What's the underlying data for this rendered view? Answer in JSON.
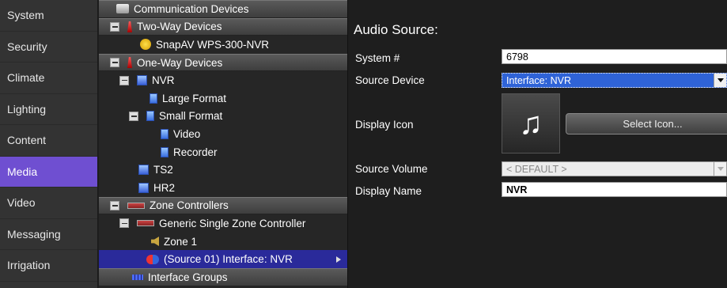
{
  "nav": {
    "items": [
      {
        "label": "System",
        "active": false
      },
      {
        "label": "Security",
        "active": false
      },
      {
        "label": "Climate",
        "active": false
      },
      {
        "label": "Lighting",
        "active": false
      },
      {
        "label": "Content",
        "active": false
      },
      {
        "label": "Media",
        "active": true
      },
      {
        "label": "Video",
        "active": false
      },
      {
        "label": "Messaging",
        "active": false
      },
      {
        "label": "Irrigation",
        "active": false
      }
    ]
  },
  "tree": {
    "communication_devices": "Communication Devices",
    "two_way_devices": "Two-Way Devices",
    "snapav": "SnapAV WPS-300-NVR",
    "one_way_devices": "One-Way Devices",
    "nvr": "NVR",
    "large_format": "Large Format",
    "small_format": "Small Format",
    "video": "Video",
    "recorder": "Recorder",
    "ts2": "TS2",
    "hr2": "HR2",
    "zone_controllers": "Zone Controllers",
    "generic_szc": "Generic Single Zone Controller",
    "zone1": "Zone 1",
    "source01": "(Source 01) Interface: NVR",
    "interface_groups": "Interface Groups"
  },
  "panel": {
    "title": "Audio Source:",
    "system_label": "System #",
    "system_value": "6798",
    "source_device_label": "Source Device",
    "source_device_value": "Interface: NVR",
    "display_icon_label": "Display Icon",
    "icon_glyph": "♫",
    "icon_semantic": "music-note-icon",
    "select_icon_label": "Select Icon...",
    "source_volume_label": "Source Volume",
    "source_volume_value": "< DEFAULT >",
    "display_name_label": "Display Name",
    "display_name_value": "NVR"
  },
  "colors": {
    "accent": "#6f4fd1",
    "selected_row": "#2a2a9a",
    "select_field": "#2f63d7"
  }
}
